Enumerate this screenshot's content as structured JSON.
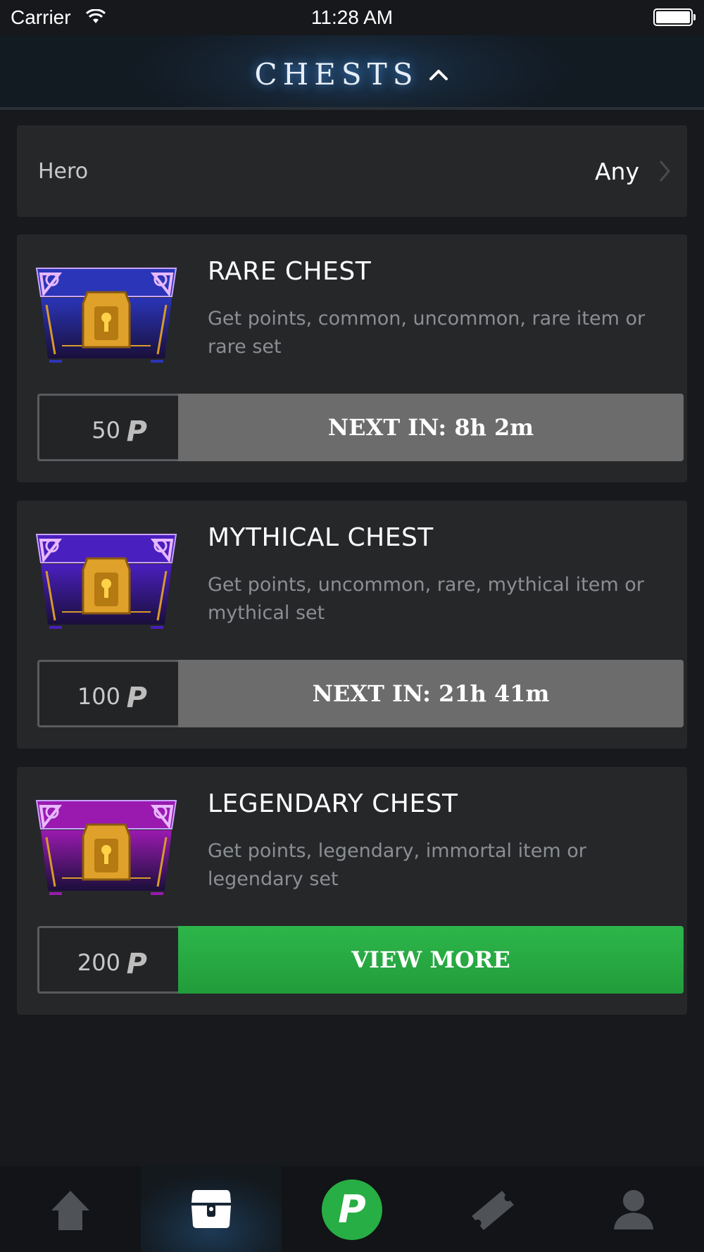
{
  "status_bar": {
    "carrier": "Carrier",
    "time": "11:28 AM"
  },
  "header": {
    "title": "CHESTS"
  },
  "filter": {
    "label": "Hero",
    "value": "Any"
  },
  "chests": [
    {
      "name": "RARE CHEST",
      "description": "Get points, common, uncommon, rare item or rare set",
      "price": "50",
      "action": "NEXT IN: 8h 2m",
      "action_state": "disabled",
      "color": "#2a35b8"
    },
    {
      "name": "MYTHICAL CHEST",
      "description": "Get points, uncommon, rare, mythical item or mythical set",
      "price": "100",
      "action": "NEXT IN: 21h 41m",
      "action_state": "disabled",
      "color": "#4a1fbf"
    },
    {
      "name": "LEGENDARY CHEST",
      "description": "Get points, legendary, immortal item or legendary set",
      "price": "200",
      "action": "VIEW MORE",
      "action_state": "active",
      "color": "#9a1ab0"
    }
  ],
  "currency_symbol": "P",
  "tabbar": {
    "items": [
      {
        "icon": "home-icon"
      },
      {
        "icon": "chest-icon",
        "selected": true
      },
      {
        "icon": "points-icon"
      },
      {
        "icon": "ticket-icon"
      },
      {
        "icon": "profile-icon"
      }
    ]
  },
  "colors": {
    "accent_green": "#27ae44",
    "background": "#17191c",
    "card": "#262729"
  }
}
